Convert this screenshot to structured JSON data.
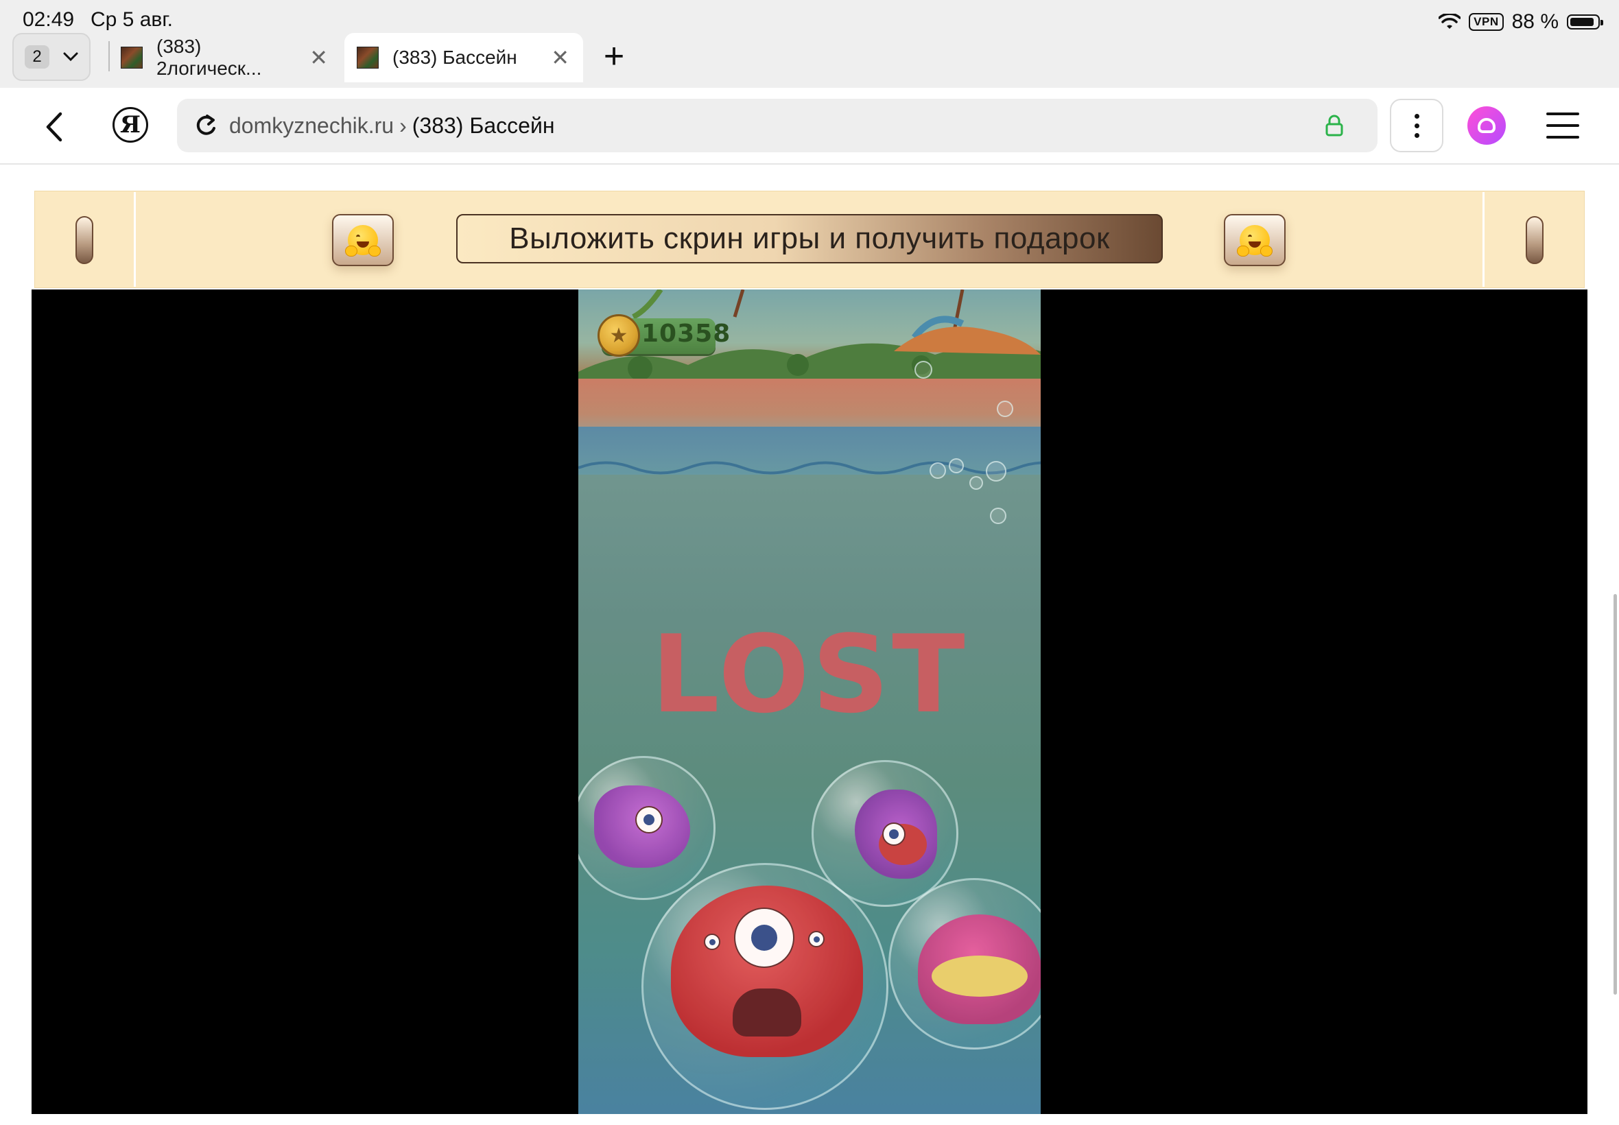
{
  "status_bar": {
    "time": "02:49",
    "date": "Ср 5 авг.",
    "vpn": "VPN",
    "battery_text": "88 %",
    "battery_level": 0.88,
    "icons": [
      "wifi-icon",
      "battery-icon"
    ]
  },
  "tabs": {
    "count": "2",
    "items": [
      {
        "title": "(383) 2логическ...",
        "active": false
      },
      {
        "title": "(383) Бассейн",
        "active": true
      }
    ],
    "close_glyph": "✕",
    "new_tab_glyph": "+"
  },
  "toolbar": {
    "yandex_glyph": "Я",
    "url_domain": "domkyznechik.ru",
    "url_separator": "›",
    "url_title": "(383) Бассейн",
    "lock_color": "#2bb34a",
    "alice_colors": [
      "#ff4fd6",
      "#b54bff"
    ]
  },
  "banner": {
    "cta_text": "Выложить скрин игры и получить подарок",
    "emoji": "hugging-face"
  },
  "game": {
    "coins": "10358",
    "status_text": "LOST"
  }
}
